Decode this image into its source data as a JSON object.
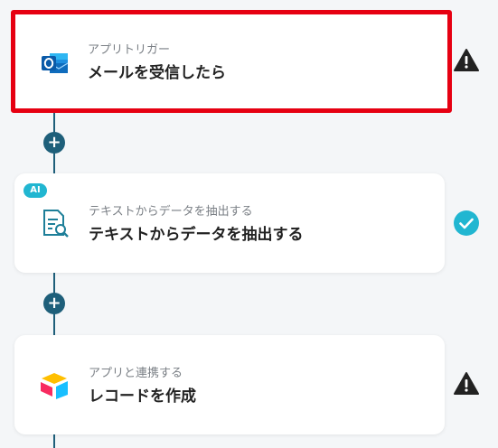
{
  "flow": {
    "steps": [
      {
        "kind": "アプリトリガー",
        "title": "メールを受信したら",
        "app_icon": "outlook-icon",
        "status_icon": "warning-icon",
        "selected": true
      },
      {
        "kind": "テキストからデータを抽出する",
        "title": "テキストからデータを抽出する",
        "app_icon": "document-search-icon",
        "badge": "AI",
        "status_icon": "check-circle-icon",
        "selected": false
      },
      {
        "kind": "アプリと連携する",
        "title": "レコードを作成",
        "app_icon": "airtable-icon",
        "status_icon": "warning-icon",
        "selected": false
      }
    ],
    "add_label": "+"
  },
  "colors": {
    "selected_border": "#e60012",
    "line": "#1e5f7a",
    "ai_badge": "#21b6d1",
    "check": "#21b6d1",
    "warning": "#222222"
  }
}
